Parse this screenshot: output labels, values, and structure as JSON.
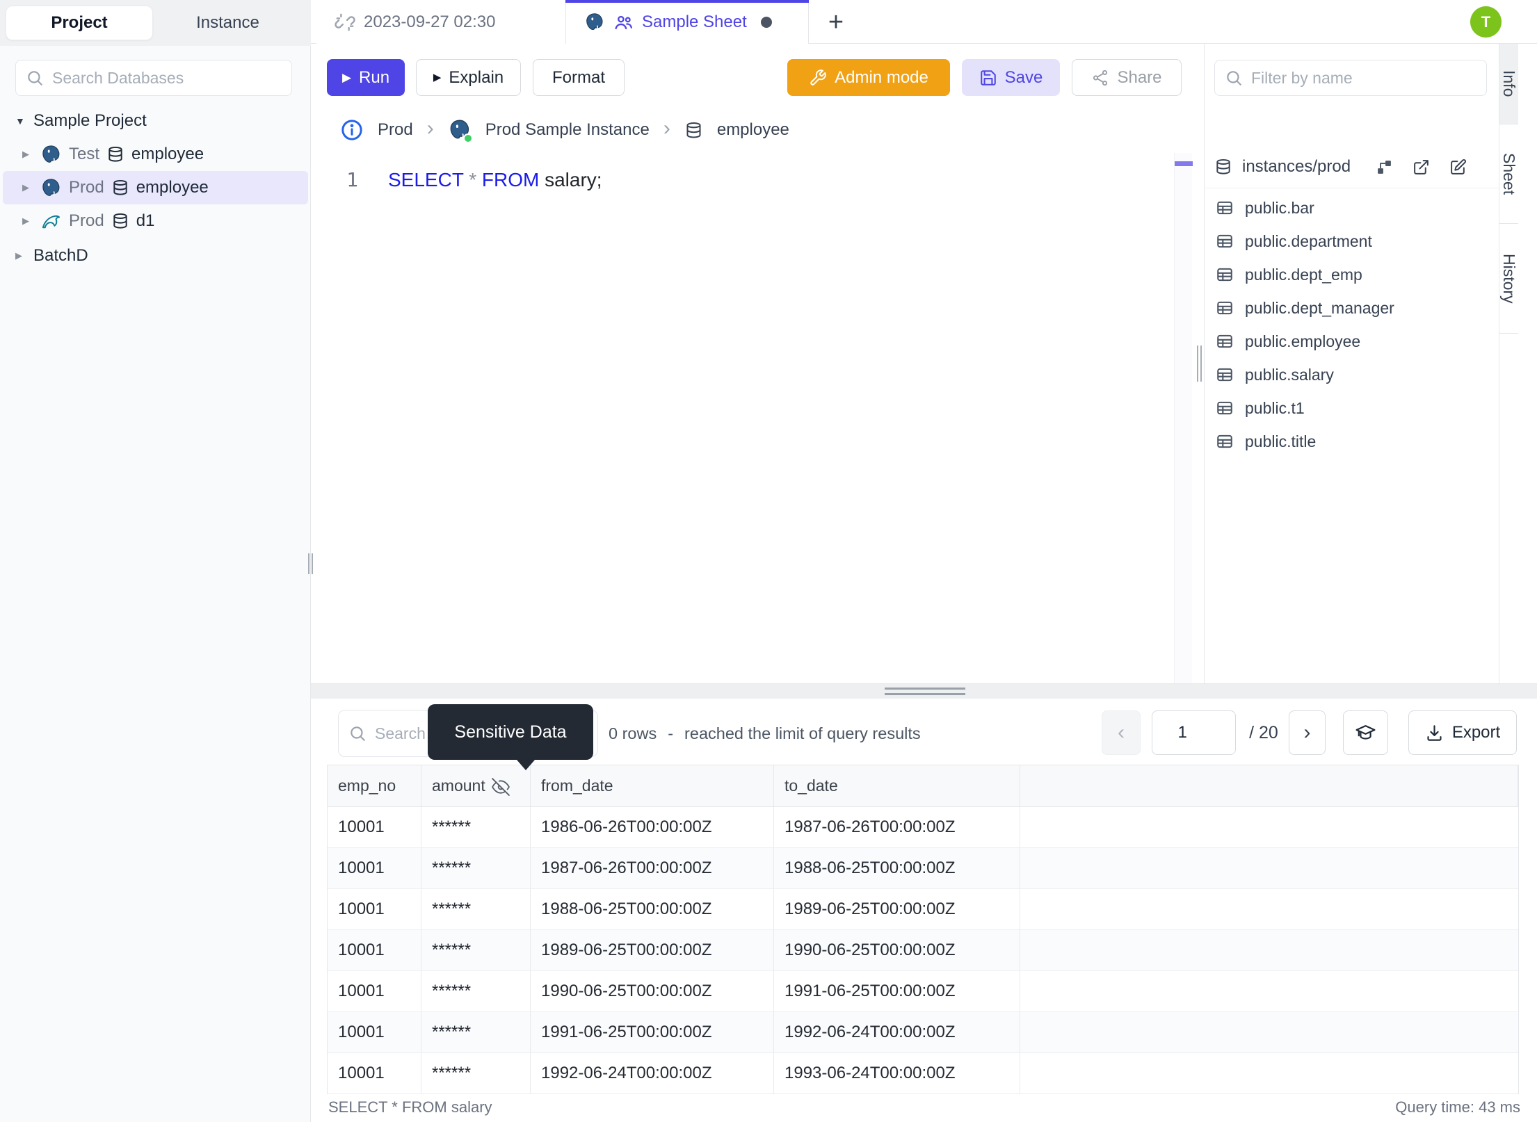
{
  "colors": {
    "accent": "#4f44e5",
    "accent-soft": "#e4e2fb",
    "admin-orange": "#f0a114",
    "avatar-green": "#7cc41c",
    "keyword-blue": "#1c1ce8",
    "tooltip-bg": "#242a34",
    "success-green": "#3fcf63"
  },
  "left_panel": {
    "tabs": {
      "project": "Project",
      "instance": "Instance"
    },
    "search_placeholder": "Search Databases",
    "tree": {
      "project_label": "Sample Project",
      "items": [
        {
          "env": "Test",
          "db": "employee"
        },
        {
          "env": "Prod",
          "db": "employee"
        },
        {
          "env": "Prod",
          "db": "d1"
        }
      ],
      "collapsed_project_label": "BatchD"
    }
  },
  "tab_bar": {
    "sheet_tab_1": "2023-09-27 02:30",
    "sheet_tab_2": "Sample Sheet",
    "new_tab": "+"
  },
  "avatar_initial": "T",
  "toolbar": {
    "run": "Run",
    "explain": "Explain",
    "format": "Format",
    "admin_mode": "Admin mode",
    "save": "Save",
    "share": "Share",
    "play_glyph": "▶"
  },
  "breadcrumb": {
    "environment": "Prod",
    "instance": "Prod Sample Instance",
    "database": "employee",
    "separator": "›"
  },
  "editor": {
    "line_number": "1",
    "kw_select": "SELECT",
    "operator": " * ",
    "kw_from": "FROM",
    "identifier": " salary;"
  },
  "right_panel": {
    "filter_placeholder": "Filter by name",
    "header_title": "instances/prod",
    "tables": [
      "public.bar",
      "public.department",
      "public.dept_emp",
      "public.dept_manager",
      "public.employee",
      "public.salary",
      "public.t1",
      "public.title"
    ],
    "side_tabs": {
      "info": "Info",
      "sheet": "Sheet",
      "history": "History"
    }
  },
  "results": {
    "search_placeholder": "Search",
    "tooltip": "Sensitive Data",
    "rows_text": "0 rows",
    "separator": "-",
    "limit_notice": "reached the limit of query results",
    "pagination": {
      "prev": "‹",
      "page": "1",
      "total": "/ 20",
      "next": "›"
    },
    "export_label": "Export",
    "table": {
      "columns": [
        "emp_no",
        "amount",
        "from_date",
        "to_date"
      ],
      "rows": [
        [
          "10001",
          "******",
          "1986-06-26T00:00:00Z",
          "1987-06-26T00:00:00Z"
        ],
        [
          "10001",
          "******",
          "1987-06-26T00:00:00Z",
          "1988-06-25T00:00:00Z"
        ],
        [
          "10001",
          "******",
          "1988-06-25T00:00:00Z",
          "1989-06-25T00:00:00Z"
        ],
        [
          "10001",
          "******",
          "1989-06-25T00:00:00Z",
          "1990-06-25T00:00:00Z"
        ],
        [
          "10001",
          "******",
          "1990-06-25T00:00:00Z",
          "1991-06-25T00:00:00Z"
        ],
        [
          "10001",
          "******",
          "1991-06-25T00:00:00Z",
          "1992-06-24T00:00:00Z"
        ],
        [
          "10001",
          "******",
          "1992-06-24T00:00:00Z",
          "1993-06-24T00:00:00Z"
        ]
      ]
    },
    "status_left": "SELECT * FROM salary",
    "status_right": "Query time: 43 ms"
  }
}
